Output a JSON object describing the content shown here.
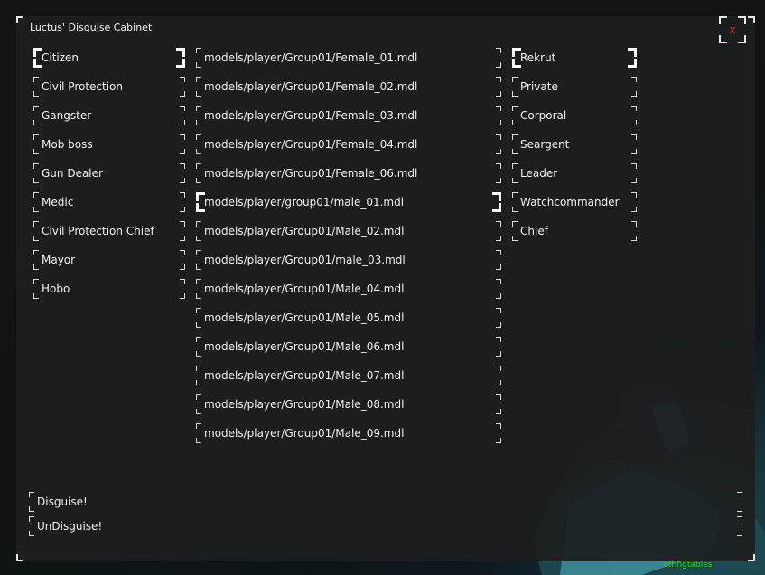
{
  "window": {
    "title": "Luctus' Disguise Cabinet",
    "close_label": "x"
  },
  "jobs": {
    "selected_index": 0,
    "items": [
      "Citizen",
      "Civil Protection",
      "Gangster",
      "Mob boss",
      "Gun Dealer",
      "Medic",
      "Civil Protection Chief",
      "Mayor",
      "Hobo"
    ]
  },
  "models": {
    "selected_index": 5,
    "items": [
      "models/player/Group01/Female_01.mdl",
      "models/player/Group01/Female_02.mdl",
      "models/player/Group01/Female_03.mdl",
      "models/player/Group01/Female_04.mdl",
      "models/player/Group01/Female_06.mdl",
      "models/player/group01/male_01.mdl",
      "models/player/Group01/Male_02.mdl",
      "models/player/Group01/male_03.mdl",
      "models/player/Group01/Male_04.mdl",
      "models/player/Group01/Male_05.mdl",
      "models/player/Group01/Male_06.mdl",
      "models/player/Group01/Male_07.mdl",
      "models/player/Group01/Male_08.mdl",
      "models/player/Group01/Male_09.mdl"
    ]
  },
  "ranks": {
    "selected_index": 0,
    "items": [
      "Rekrut",
      "Private",
      "Corporal",
      "Seargent",
      "Leader",
      "Watchcommander",
      "Chief"
    ]
  },
  "actions": {
    "disguise_label": "Disguise!",
    "undisguise_label": "UnDisguise!"
  },
  "debug": {
    "stringtables_label": "stringtables"
  },
  "colors": {
    "close": "#e0201e",
    "debug_text": "#38c238",
    "panel_bg": "#1c1e20",
    "accent_teal": "#3c96a5"
  }
}
